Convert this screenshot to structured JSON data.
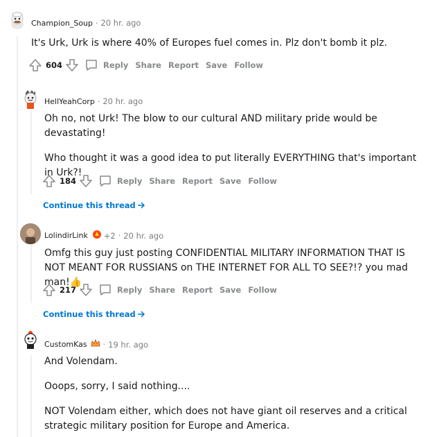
{
  "comments": [
    {
      "author": "Champion_Soup",
      "time": "20 hr. ago",
      "paragraphs": [
        "It's Urk, Urk is where 40% of Europes fuel comes in. Plz don't bomb it plz."
      ],
      "score": "604",
      "actions": {
        "reply": "Reply",
        "share": "Share",
        "report": "Report",
        "save": "Save",
        "follow": "Follow"
      }
    },
    {
      "author": "HellYeahCorp",
      "time": "20 hr. ago",
      "paragraphs": [
        "Oh no, not Urk! The blow to our cultural AND military pride would be devastating!",
        "Who thought it was a good idea to put literally EVERYTHING that's important in Urk?!"
      ],
      "score": "184",
      "actions": {
        "reply": "Reply",
        "share": "Share",
        "report": "Report",
        "save": "Save",
        "follow": "Follow"
      },
      "continue": "Continue this thread"
    },
    {
      "author": "LolindirLink",
      "award_count": "+2",
      "time": "20 hr. ago",
      "paragraphs": [
        "Omfg this guy just posting CONFIDENTIAL MILITARY INFORMATION THAT IS NOT MEANT FOR RUSSIANS on THE INTERNET FOR ALL TO SEE?!? you mad man!👍"
      ],
      "score": "217",
      "actions": {
        "reply": "Reply",
        "share": "Share",
        "report": "Report",
        "save": "Save",
        "follow": "Follow"
      },
      "continue": "Continue this thread"
    },
    {
      "author": "CustomKas",
      "time": "19 hr. ago",
      "paragraphs": [
        "And Volendam.",
        "Ooops, sorry, I said nothing....",
        "NOT Volendam either, which does not have giant oil reserves and a critical strategic military position for Europe and America."
      ]
    }
  ],
  "icons": {
    "upvote": "upvote-arrow-icon",
    "downvote": "downvote-arrow-icon",
    "reply": "speech-bubble-icon",
    "continue": "arrow-right-icon"
  },
  "colors": {
    "link": "#0079d3",
    "muted": "#878a8c",
    "thread_line": "#edeff1"
  }
}
